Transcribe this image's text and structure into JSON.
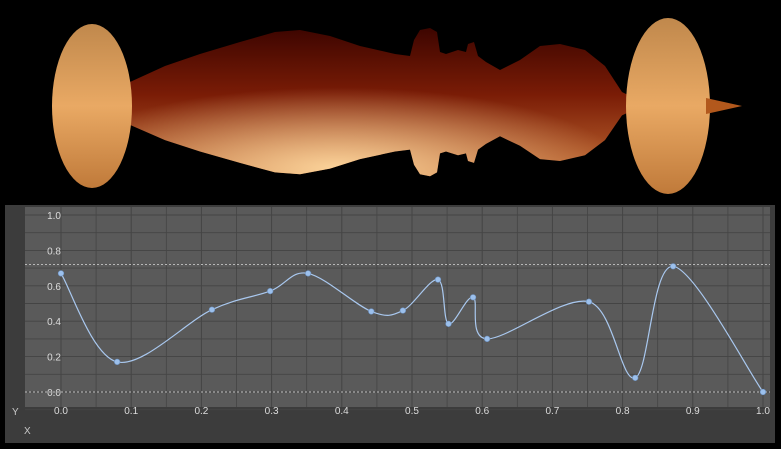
{
  "preview": {
    "gradient_colors": [
      "#f2b46a",
      "#c06a32",
      "#7a1c06",
      "#3d0500"
    ]
  },
  "spline_editor": {
    "axis_x_label": "X",
    "axis_y_label": "Y",
    "x_ticks": [
      "0.0",
      "0.1",
      "0.2",
      "0.3",
      "0.4",
      "0.5",
      "0.6",
      "0.7",
      "0.8",
      "0.9",
      "1.0"
    ],
    "y_ticks": [
      "0.0",
      "0.2",
      "0.4",
      "0.6",
      "0.8",
      "1.0"
    ],
    "max_line_value": 0.72,
    "zero_line_value": 0.0,
    "control_points": [
      {
        "x": 0.0,
        "y": 0.67
      },
      {
        "x": 0.08,
        "y": 0.17
      },
      {
        "x": 0.215,
        "y": 0.465
      },
      {
        "x": 0.298,
        "y": 0.57
      },
      {
        "x": 0.352,
        "y": 0.67
      },
      {
        "x": 0.442,
        "y": 0.455
      },
      {
        "x": 0.487,
        "y": 0.46
      },
      {
        "x": 0.537,
        "y": 0.635
      },
      {
        "x": 0.552,
        "y": 0.385
      },
      {
        "x": 0.587,
        "y": 0.535
      },
      {
        "x": 0.607,
        "y": 0.3
      },
      {
        "x": 0.752,
        "y": 0.51
      },
      {
        "x": 0.818,
        "y": 0.08
      },
      {
        "x": 0.872,
        "y": 0.71
      },
      {
        "x": 1.0,
        "y": 0.0
      }
    ],
    "colors": {
      "panel": "#3c3c3c",
      "plot": "#5a5a5a",
      "grid": "#444444",
      "curve": "#a9c8ef",
      "point": "#9cc0ec",
      "guide": "#b8b8b8"
    }
  }
}
